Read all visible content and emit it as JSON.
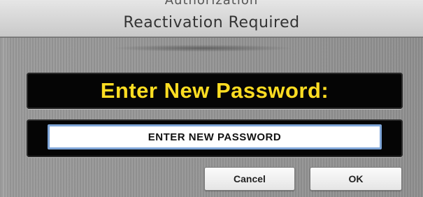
{
  "window": {
    "ghost_title": "Authorization",
    "title": "Reactivation Required"
  },
  "banner": {
    "text": "Enter New Password:",
    "text_color": "#ffdd22"
  },
  "password_field": {
    "value": "ENTER NEW PASSWORD",
    "focus_ring_color": "#7fa6d8"
  },
  "buttons": {
    "cancel_label": "Cancel",
    "ok_label": "OK"
  }
}
